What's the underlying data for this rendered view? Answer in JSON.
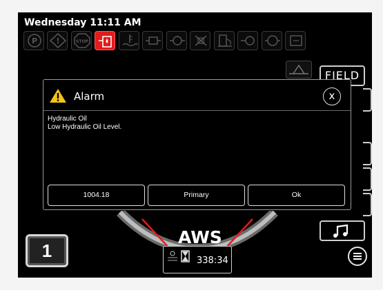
{
  "status_bar": {
    "datetime": "Wednesday 11:11 AM"
  },
  "indicators": [
    {
      "name": "parking-brake-icon",
      "active": false
    },
    {
      "name": "caution-icon",
      "active": false
    },
    {
      "name": "stop-icon",
      "label": "STOP",
      "active": false
    },
    {
      "name": "hydraulic-oil-icon",
      "active": true
    },
    {
      "name": "coolant-temp-icon",
      "active": false
    },
    {
      "name": "engine-oil-pressure-icon",
      "active": false
    },
    {
      "name": "transmission-icon",
      "active": false
    },
    {
      "name": "hydraulic-filter-icon",
      "active": false
    },
    {
      "name": "fuel-level-icon",
      "active": false
    },
    {
      "name": "air-filter-icon",
      "active": false
    },
    {
      "name": "oil-filter-icon",
      "active": false
    },
    {
      "name": "alternator-icon",
      "active": false
    }
  ],
  "side_panel": {
    "field_label": "FIELD"
  },
  "alarm_dialog": {
    "title": "Alarm",
    "close_glyph": "x",
    "message_title": "Hydraulic Oil",
    "message_detail": "Low Hydraulic Oil Level.",
    "buttons": {
      "code": "1004.18",
      "source": "Primary",
      "ok": "Ok"
    }
  },
  "bottom": {
    "gear": "1",
    "mode": "AWS",
    "hour_meter": "338:34"
  },
  "colors": {
    "alert_red": "#e31b1b",
    "warning_yellow": "#f3c316",
    "background": "#000000"
  }
}
